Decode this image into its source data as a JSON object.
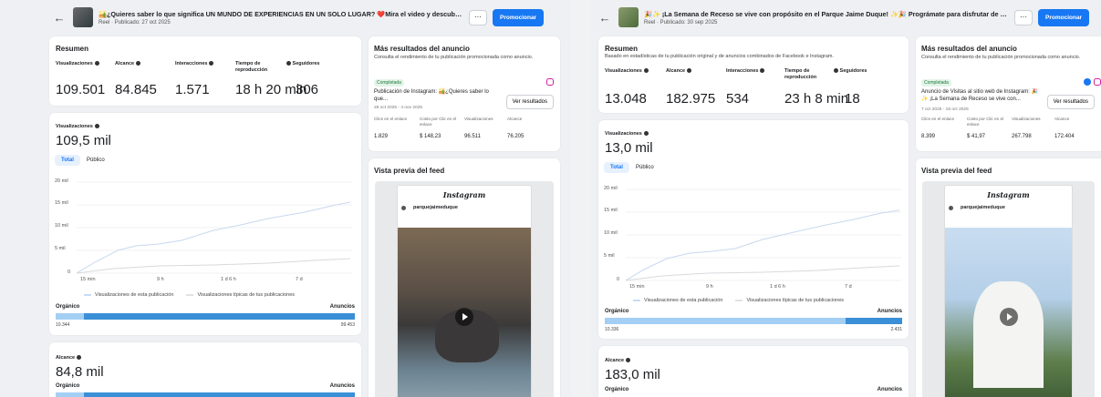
{
  "left": {
    "title": "🏜️¿Quieres saber lo que significa UN MUNDO DE EXPERIENCIAS EN UN SOLO LUGAR? ❤️Mira el video y descubre lo que en...",
    "subtitle": "Reel · Publicado: 27 oct 2025",
    "dots": "···",
    "promote": "Promocionar",
    "resumen": {
      "title": "Resumen",
      "subtitle": "",
      "metrics": [
        {
          "label": "Visualizaciones",
          "value": "109.501"
        },
        {
          "label": "Alcance",
          "value": "84.845"
        },
        {
          "label": "Interacciones",
          "value": "1.571"
        },
        {
          "label": "Tiempo de reproducción",
          "value": "18 h 20 min"
        },
        {
          "label": "Seguidores",
          "value": "306"
        }
      ]
    },
    "views": {
      "label": "Visualizaciones",
      "value": "109,5 mil",
      "tab_total": "Total",
      "tab_public": "Público",
      "yticks": [
        "20 mil",
        "15 mil",
        "10 mil",
        "5 mil",
        "0"
      ],
      "xticks": [
        "15 min",
        "9 h",
        "1 d 6 h",
        "7 d"
      ],
      "legend1": "Visualizaciones de esta publicación",
      "legend2": "Visualizaciones típicas de tus publicaciones",
      "organic": "Orgánico",
      "ads": "Anuncios",
      "organic_value": "10.344",
      "ads_value": "99.453"
    },
    "reach": {
      "label": "Alcance",
      "value": "84,8 mil",
      "organic": "Orgánico",
      "ads": "Anuncios"
    },
    "ad": {
      "title": "Más resultados del anuncio",
      "subtitle": "Consulta el rendimiento de tu publicación promocionada como anuncio.",
      "badge": "Completada",
      "desc": "Publicación de Instagram: 🏜️¿Quieres saber lo que...",
      "date": "28 oct 2025 - 4 nov 2025",
      "button": "Ver resultados",
      "stat_labels": [
        "Clics en el enlace",
        "Costo por Clic en el enlace",
        "Visualizaciones",
        "Alcance"
      ],
      "stat_values": [
        "1.829",
        "$ 148,23",
        "96.511",
        "76.205"
      ]
    },
    "feed": {
      "title": "Vista previa del feed",
      "brand": "Instagram",
      "account": "parquejaimeduque"
    }
  },
  "right": {
    "title": "🎉✨ ¡La Semana de Receso se vive con propósito en el Parque Jaime Duque! ✨🎉 Prográmate para disfrutar de unos días ...",
    "subtitle": "Reel · Publicado: 30 sep 2025",
    "dots": "···",
    "promote": "Promocionar",
    "resumen": {
      "title": "Resumen",
      "subtitle": "Basado en estadísticas de tu publicación original y de anuncios combinados de Facebook e Instagram.",
      "metrics": [
        {
          "label": "Visualizaciones",
          "value": "13.048"
        },
        {
          "label": "Alcance",
          "value": "182.975"
        },
        {
          "label": "Interacciones",
          "value": "534"
        },
        {
          "label": "Tiempo de reproducción",
          "value": "23 h 8 min"
        },
        {
          "label": "Seguidores",
          "value": "18"
        }
      ]
    },
    "views": {
      "label": "Visualizaciones",
      "value": "13,0 mil",
      "tab_total": "Total",
      "tab_public": "Público",
      "yticks": [
        "20 mil",
        "15 mil",
        "10 mil",
        "5 mil",
        "0"
      ],
      "xticks": [
        "15 min",
        "9 h",
        "1 d 6 h",
        "7 d"
      ],
      "legend1": "Visualizaciones de esta publicación",
      "legend2": "Visualizaciones típicas de tus publicaciones",
      "organic": "Orgánico",
      "ads": "Anuncios",
      "organic_value": "10.336",
      "ads_value": "2.431"
    },
    "reach": {
      "label": "Alcance",
      "value": "183,0 mil",
      "organic": "Orgánico",
      "ads": "Anuncios"
    },
    "ad": {
      "title": "Más resultados del anuncio",
      "subtitle": "Consulta el rendimiento de tu publicación promocionada como anuncio.",
      "badge": "Completada",
      "desc": "Anuncio de Visitas al sitio web de Instagram: 🎉✨ ¡La Semana de Receso se vive con...",
      "date": "7 oct 2025 - 16 oct 2025",
      "button": "Ver resultados",
      "stat_labels": [
        "Clics en el enlace",
        "Costo por Clic en el enlace",
        "Visualizaciones",
        "Alcance"
      ],
      "stat_values": [
        "8.399",
        "$ 41,97",
        "267.798",
        "172.404"
      ]
    },
    "feed": {
      "title": "Vista previa del feed",
      "brand": "Instagram",
      "account": "parquejaimeduque"
    }
  }
}
